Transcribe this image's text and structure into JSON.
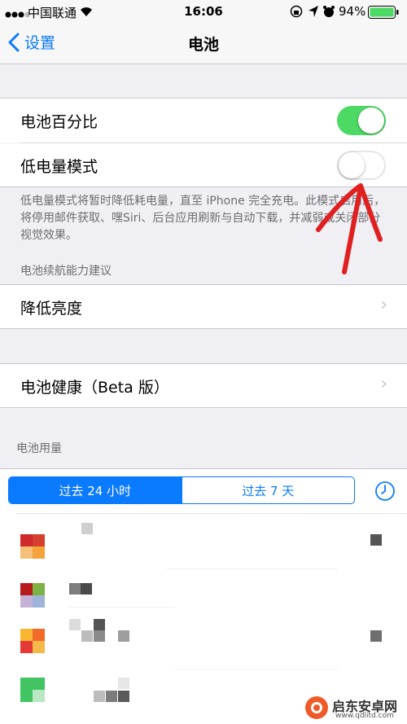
{
  "status_bar": {
    "carrier": "中国联通",
    "time": "16:06",
    "battery_pct": "94%"
  },
  "nav": {
    "back_label": "设置",
    "title": "电池"
  },
  "settings": {
    "battery_percentage_label": "电池百分比",
    "battery_percentage_on": true,
    "low_power_label": "低电量模式",
    "low_power_on": false,
    "low_power_footnote": "低电量模式将暂时降低耗电量，直至 iPhone 完全充电。此模式启用后，将停用邮件获取、嘿Siri、后台应用刷新与自动下载，并减弱或关闭部分视觉效果。",
    "suggestions_header": "电池续航能力建议",
    "reduce_brightness_label": "降低亮度",
    "battery_health_label": "电池健康（Beta 版）",
    "usage_header": "电池用量"
  },
  "usage_tabs": [
    {
      "label": "过去 24 小时",
      "selected": true
    },
    {
      "label": "过去 7 天",
      "selected": false
    }
  ],
  "watermark": {
    "name": "启东安卓网",
    "url": "www.qdlitd.com"
  },
  "colors": {
    "accent": "#0a7aff",
    "toggle_on": "#4cd964",
    "annotation_red": "#e02020"
  }
}
